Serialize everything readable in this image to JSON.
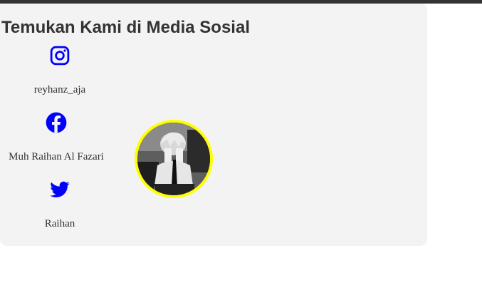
{
  "section": {
    "title": "Temukan Kami di Media Sosial"
  },
  "socials": [
    {
      "icon": "instagram-icon",
      "label": "reyhanz_aja"
    },
    {
      "icon": "facebook-icon",
      "label": "Muh Raihan Al Fazari"
    },
    {
      "icon": "twitter-icon",
      "label": "Raihan"
    }
  ],
  "colors": {
    "icon": "#0000ff",
    "avatar_border": "#ffff00",
    "card_bg": "#f3f3f3",
    "top_bar": "#333333"
  },
  "avatar": {
    "description_icon": "profile-avatar-image"
  }
}
